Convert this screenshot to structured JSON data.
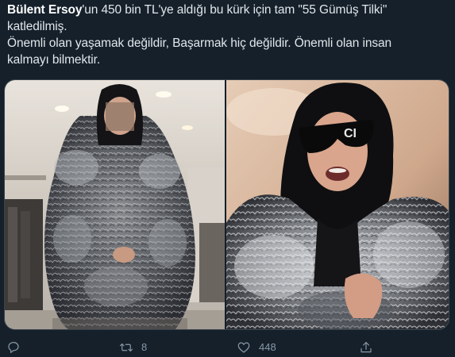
{
  "tweet": {
    "author_mention": "Bülent Ersoy",
    "line1_rest": "'un 450 bin TL'ye aldığı bu kürk için tam \"55 Gümüş Tilki\"",
    "line2": "katledilmiş.",
    "paragraph2_line1": "Önemli olan yaşamak değildir, Başarmak hiç değildir. Önemli olan insan",
    "paragraph2_line2": "kalmayı bilmektir."
  },
  "actions": {
    "reply": {
      "icon": "reply-icon",
      "count": ""
    },
    "retweet": {
      "icon": "retweet-icon",
      "count": "8"
    },
    "like": {
      "icon": "heart-icon",
      "count": "448"
    },
    "share": {
      "icon": "share-icon",
      "count": ""
    }
  },
  "colors": {
    "background": "#15202b",
    "text": "#e1e6ea",
    "muted": "#8899a6",
    "border": "#38444d"
  }
}
